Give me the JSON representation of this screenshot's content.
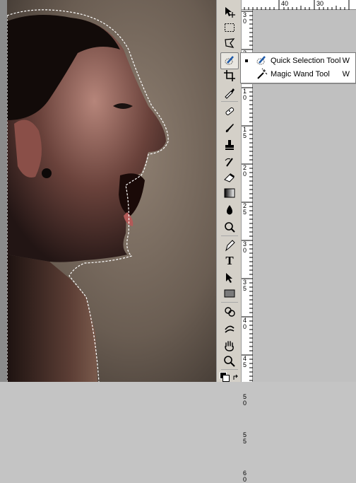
{
  "toolbar": {
    "tools": [
      {
        "name": "move-tool"
      },
      {
        "name": "marquee-tool"
      },
      {
        "name": "lasso-tool"
      },
      {
        "name": "quick-selection-tool"
      },
      {
        "name": "crop-tool"
      },
      {
        "name": "eyedropper-tool"
      },
      {
        "name": "healing-brush-tool"
      },
      {
        "name": "brush-tool"
      },
      {
        "name": "clone-stamp-tool"
      },
      {
        "name": "history-brush-tool"
      },
      {
        "name": "eraser-tool"
      },
      {
        "name": "gradient-tool"
      },
      {
        "name": "blur-tool"
      },
      {
        "name": "dodge-tool"
      },
      {
        "name": "pen-tool"
      },
      {
        "name": "type-tool"
      },
      {
        "name": "path-selection-tool"
      },
      {
        "name": "rectangle-tool"
      },
      {
        "name": "3d-rotate-tool"
      },
      {
        "name": "3d-orbit-tool"
      },
      {
        "name": "hand-tool"
      },
      {
        "name": "zoom-tool"
      }
    ],
    "type_glyph": "T"
  },
  "flyout": {
    "items": [
      {
        "label": "Quick Selection Tool",
        "shortcut": "W",
        "selected": true
      },
      {
        "label": "Magic Wand Tool",
        "shortcut": "W",
        "selected": false
      }
    ]
  },
  "rulers": {
    "horizontal": [
      "40",
      "30"
    ],
    "vertical": [
      "3",
      "0",
      "3",
      "5",
      "1",
      "0",
      "1",
      "5",
      "2",
      "0",
      "2",
      "5",
      "3",
      "0",
      "3",
      "5",
      "4",
      "0",
      "4",
      "5",
      "5",
      "0",
      "5",
      "5",
      "6",
      "0"
    ]
  },
  "colors": {
    "toolbar_bg": "#d4d0c8",
    "workspace_bg": "#c0c0c0",
    "selection_ants": "#ffffff"
  }
}
